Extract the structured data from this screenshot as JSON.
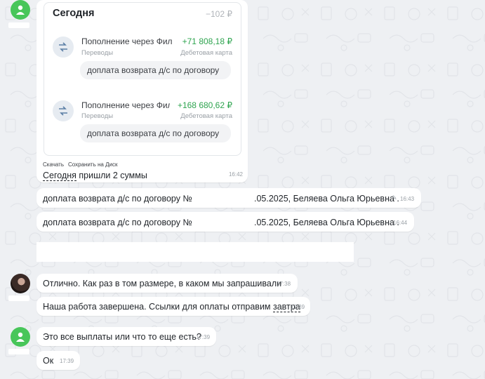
{
  "chat": {
    "card_message": {
      "card": {
        "title": "Сегодня",
        "total": "−102 ₽",
        "transactions": [
          {
            "title": "Пополнение через Фил",
            "amount": "+71 808,18 ₽",
            "category": "Переводы",
            "source": "Дебетовая карта",
            "note": "доплата возврата д/с по договору"
          },
          {
            "title": "Пополнение через Фил",
            "amount": "+168 680,62 ₽",
            "category": "Переводы",
            "source": "Дебетовая карта",
            "note": "доплата возврата д/с по договору"
          }
        ]
      },
      "actions": {
        "download": "Скачать",
        "save": "Сохранить на Диск"
      },
      "caption_underlined": "Сегодня",
      "caption_rest": " пришли 2 суммы",
      "time": "16:42"
    },
    "msg1": {
      "left": "доплата возврата д/с по договору №",
      "right": ".05.2025, Беляева Ольга Юрьевна .",
      "time": "16:43",
      "edited": "✎"
    },
    "msg2": {
      "left": "доплата возврата д/с по договору №",
      "right": ".05.2025, Беляева Ольга Юрьевна .",
      "time": "16:44"
    },
    "msg3": {
      "text": "Отлично. Как раз в том размере, в каком мы запрашивали",
      "time": "17:38"
    },
    "msg4": {
      "text_start": "Наша работа завершена. Ссылки для оплаты отправим ",
      "text_link": "завтра",
      "time": "17:39"
    },
    "msg5": {
      "text": "Это все выплаты или что то еще есть?",
      "time": "17:39"
    },
    "msg6": {
      "text": "Ок",
      "time": "17:39"
    }
  },
  "colors": {
    "background": "#eef0f3",
    "bubble": "#ffffff",
    "amount_positive": "#2ea44f",
    "avatar_green": "#48c65a"
  },
  "icons": {
    "avatar": "person-icon",
    "transfer": "transfer-arrows-icon",
    "edited": "pencil-icon"
  }
}
